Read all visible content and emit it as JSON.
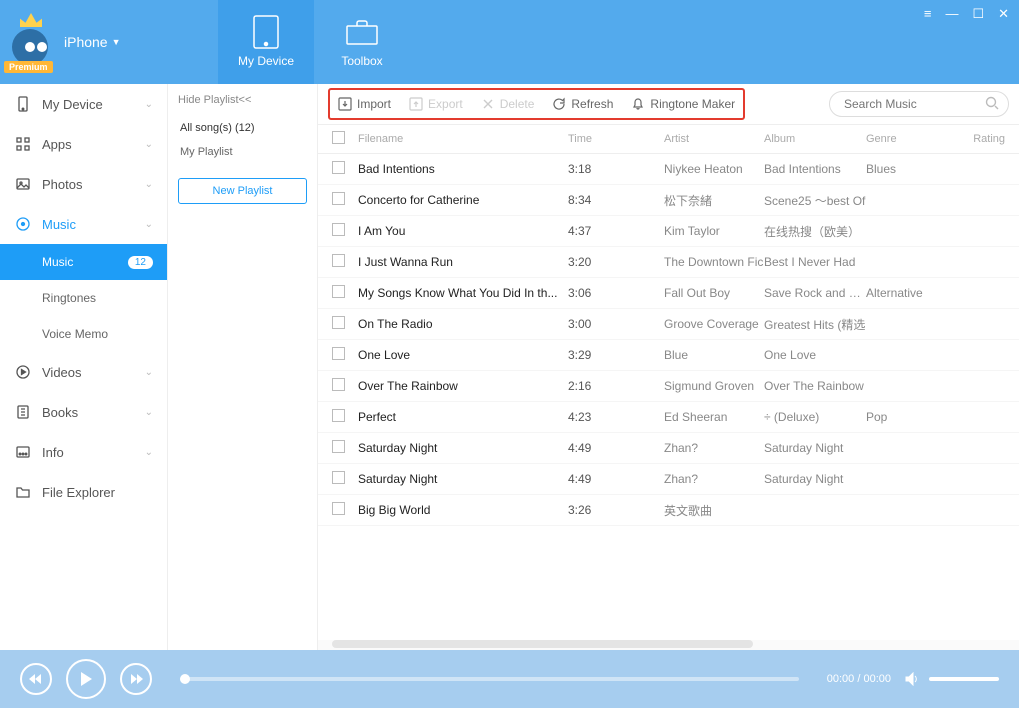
{
  "header": {
    "device_label": "iPhone",
    "premium_label": "Premium",
    "my_device_tab": "My Device",
    "toolbox_tab": "Toolbox"
  },
  "sidebar": {
    "items": [
      {
        "icon": "device",
        "label": "My Device",
        "chev": true
      },
      {
        "icon": "apps",
        "label": "Apps",
        "chev": true
      },
      {
        "icon": "photos",
        "label": "Photos",
        "chev": true
      },
      {
        "icon": "music",
        "label": "Music",
        "chev": true,
        "active": true
      },
      {
        "icon": "videos",
        "label": "Videos",
        "chev": true
      },
      {
        "icon": "books",
        "label": "Books",
        "chev": true
      },
      {
        "icon": "info",
        "label": "Info",
        "chev": true
      },
      {
        "icon": "folder",
        "label": "File Explorer",
        "chev": false
      }
    ],
    "music_sub": [
      {
        "label": "Music",
        "badge": "12",
        "selected": true
      },
      {
        "label": "Ringtones"
      },
      {
        "label": "Voice Memo"
      }
    ]
  },
  "playlist": {
    "hide_label": "Hide Playlist<<",
    "items": [
      {
        "label": "All song(s) (12)",
        "active": true
      },
      {
        "label": "My Playlist"
      }
    ],
    "new_button": "New Playlist"
  },
  "toolbar": {
    "import": "Import",
    "export": "Export",
    "delete": "Delete",
    "refresh": "Refresh",
    "ringtone": "Ringtone Maker",
    "search_placeholder": "Search Music"
  },
  "columns": {
    "filename": "Filename",
    "time": "Time",
    "artist": "Artist",
    "album": "Album",
    "genre": "Genre",
    "rating": "Rating"
  },
  "songs": [
    {
      "filename": "Bad Intentions",
      "time": "3:18",
      "artist": "Niykee Heaton",
      "album": "Bad Intentions",
      "genre": "Blues"
    },
    {
      "filename": "Concerto for Catherine",
      "time": "8:34",
      "artist": "松下奈緒",
      "album": "Scene25 ～best Of",
      "genre": ""
    },
    {
      "filename": "I Am You",
      "time": "4:37",
      "artist": "Kim Taylor",
      "album": "在线热搜（欧美）",
      "genre": ""
    },
    {
      "filename": "I Just Wanna Run",
      "time": "3:20",
      "artist": "The Downtown Fic",
      "album": "Best I Never Had",
      "genre": ""
    },
    {
      "filename": "My Songs Know What You Did In th...",
      "time": "3:06",
      "artist": "Fall Out Boy",
      "album": "Save Rock and Rol",
      "genre": "Alternative"
    },
    {
      "filename": "On The Radio",
      "time": "3:00",
      "artist": "Groove Coverage",
      "album": "Greatest Hits (精选",
      "genre": ""
    },
    {
      "filename": "One Love",
      "time": "3:29",
      "artist": "Blue",
      "album": "One Love",
      "genre": ""
    },
    {
      "filename": "Over The Rainbow",
      "time": "2:16",
      "artist": "Sigmund Groven",
      "album": "Over The Rainbow",
      "genre": ""
    },
    {
      "filename": "Perfect",
      "time": "4:23",
      "artist": "Ed Sheeran",
      "album": "÷ (Deluxe)",
      "genre": "Pop"
    },
    {
      "filename": "Saturday Night",
      "time": "4:49",
      "artist": "Zhan?",
      "album": "Saturday Night",
      "genre": ""
    },
    {
      "filename": "Saturday Night",
      "time": "4:49",
      "artist": "Zhan?",
      "album": "Saturday Night",
      "genre": ""
    },
    {
      "filename": "Big Big World",
      "time": "3:26",
      "artist": "英文歌曲",
      "album": "",
      "genre": ""
    }
  ],
  "player": {
    "time": "00:00 / 00:00"
  }
}
